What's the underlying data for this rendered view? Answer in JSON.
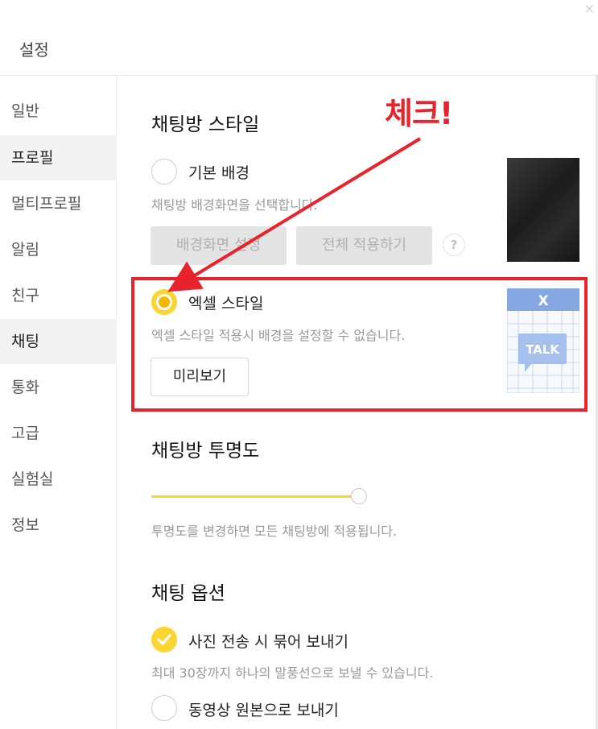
{
  "window": {
    "close_glyph": "×"
  },
  "header": {
    "title": "설정"
  },
  "sidebar": {
    "items": [
      {
        "label": "일반"
      },
      {
        "label": "프로필"
      },
      {
        "label": "멀티프로필"
      },
      {
        "label": "알림"
      },
      {
        "label": "친구"
      },
      {
        "label": "채팅"
      },
      {
        "label": "통화"
      },
      {
        "label": "고급"
      },
      {
        "label": "실험실"
      },
      {
        "label": "정보"
      }
    ],
    "active": "채팅"
  },
  "chat_room_style": {
    "title": "채팅방 스타일",
    "basic_bg": {
      "label": "기본 배경",
      "description": "채팅방 배경화면을 선택합니다.",
      "set_bg_button": "배경화면 설정",
      "apply_all_button": "전체 적용하기",
      "help_glyph": "?",
      "selected": false
    },
    "excel_style": {
      "label": "엑셀 스타일",
      "description": "엑셀 스타일 적용시 배경을 설정할 수 없습니다.",
      "preview_button": "미리보기",
      "selected": true,
      "thumbnail_text": "TALK",
      "thumbnail_logo": "X"
    }
  },
  "annotation": {
    "text": "체크!",
    "color": "#e8232b"
  },
  "transparency": {
    "title": "채팅방 투명도",
    "value_fraction": 0.97,
    "description": "투명도를 변경하면 모든 채팅방에 적용됩니다."
  },
  "chat_options": {
    "title": "채팅 옵션",
    "options": [
      {
        "label": "사진 전송 시 묶어 보내기",
        "description": "최대 30장까지 하나의 말풍선으로 보낼 수 있습니다.",
        "checked": true
      },
      {
        "label": "동영상 원본으로 보내기",
        "checked": false
      }
    ]
  },
  "colors": {
    "accent": "#fbd530",
    "accent_dark": "#f7b500",
    "annotation_red": "#e8232b"
  }
}
